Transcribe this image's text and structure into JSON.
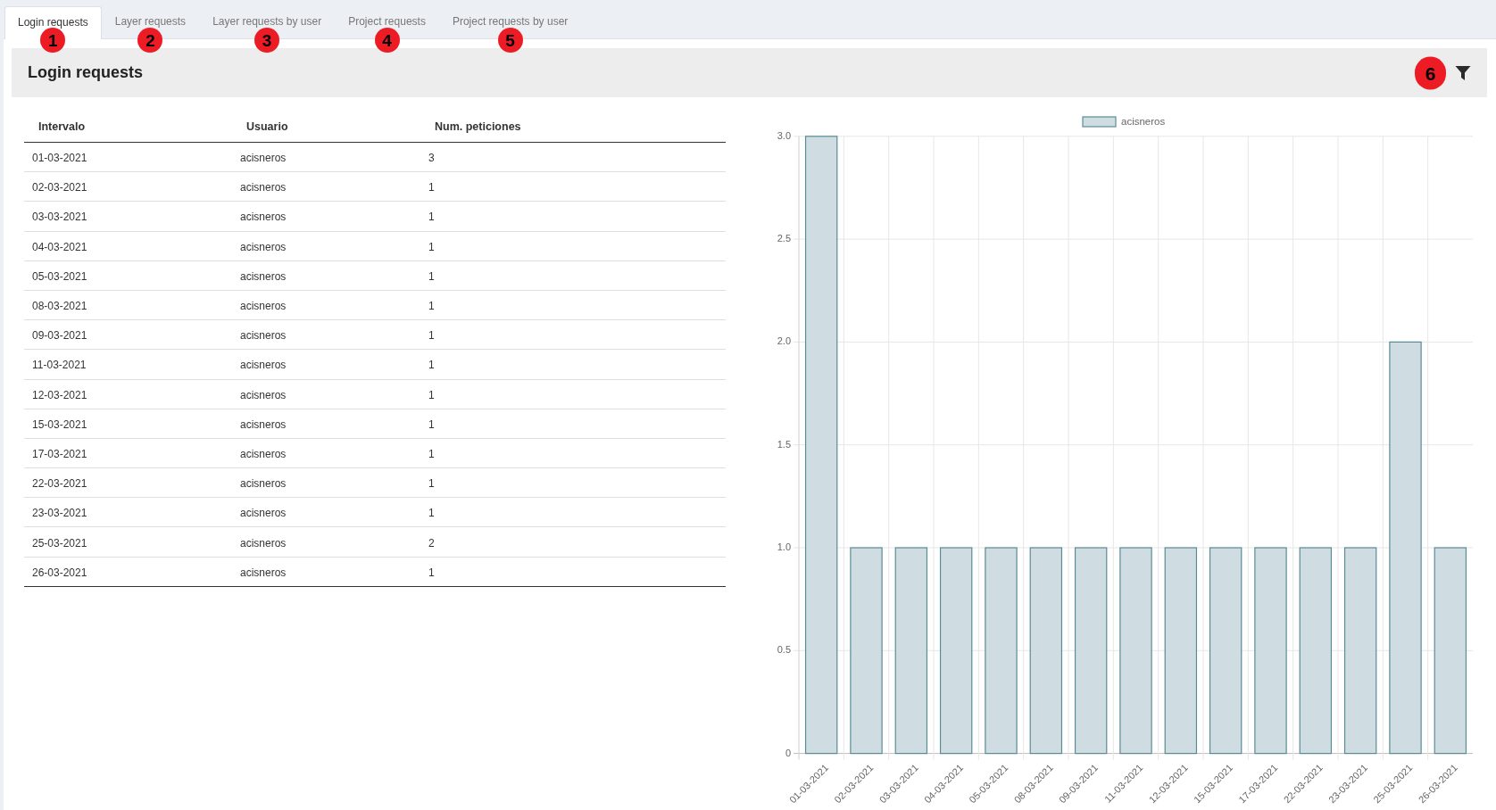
{
  "tabs": [
    {
      "label": "Login requests",
      "selected": true,
      "callout": "1"
    },
    {
      "label": "Layer requests",
      "selected": false,
      "callout": "2"
    },
    {
      "label": "Layer requests by user",
      "selected": false,
      "callout": "3"
    },
    {
      "label": "Project requests",
      "selected": false,
      "callout": "4"
    },
    {
      "label": "Project requests by user",
      "selected": false,
      "callout": "5"
    }
  ],
  "panel": {
    "title": "Login requests",
    "filter_button": {
      "callout": "6"
    }
  },
  "table": {
    "columns": [
      "Intervalo",
      "Usuario",
      "Num. peticiones"
    ],
    "rows": [
      [
        "01-03-2021",
        "acisneros",
        "3"
      ],
      [
        "02-03-2021",
        "acisneros",
        "1"
      ],
      [
        "03-03-2021",
        "acisneros",
        "1"
      ],
      [
        "04-03-2021",
        "acisneros",
        "1"
      ],
      [
        "05-03-2021",
        "acisneros",
        "1"
      ],
      [
        "08-03-2021",
        "acisneros",
        "1"
      ],
      [
        "09-03-2021",
        "acisneros",
        "1"
      ],
      [
        "11-03-2021",
        "acisneros",
        "1"
      ],
      [
        "12-03-2021",
        "acisneros",
        "1"
      ],
      [
        "15-03-2021",
        "acisneros",
        "1"
      ],
      [
        "17-03-2021",
        "acisneros",
        "1"
      ],
      [
        "22-03-2021",
        "acisneros",
        "1"
      ],
      [
        "23-03-2021",
        "acisneros",
        "1"
      ],
      [
        "25-03-2021",
        "acisneros",
        "2"
      ],
      [
        "26-03-2021",
        "acisneros",
        "1"
      ]
    ]
  },
  "chart": {
    "chart_data": {
      "type": "bar",
      "grid": true,
      "categories": [
        "01-03-2021",
        "02-03-2021",
        "03-03-2021",
        "04-03-2021",
        "05-03-2021",
        "08-03-2021",
        "09-03-2021",
        "11-03-2021",
        "12-03-2021",
        "15-03-2021",
        "17-03-2021",
        "22-03-2021",
        "23-03-2021",
        "25-03-2021",
        "26-03-2021"
      ],
      "series": [
        {
          "name": "acisneros",
          "color": "#cfdde2",
          "values": [
            3,
            1,
            1,
            1,
            1,
            1,
            1,
            1,
            1,
            1,
            1,
            1,
            1,
            2,
            1
          ]
        }
      ],
      "ylim": [
        0,
        3
      ],
      "yticks": [
        {
          "value": 0,
          "label": "0"
        },
        {
          "value": 0.5,
          "label": "0.5"
        },
        {
          "value": 1,
          "label": "1.0"
        },
        {
          "value": 1.5,
          "label": "1.5"
        },
        {
          "value": 2,
          "label": "2.0"
        },
        {
          "value": 2.5,
          "label": "2.5"
        },
        {
          "value": 3,
          "label": "3.0"
        }
      ]
    }
  }
}
